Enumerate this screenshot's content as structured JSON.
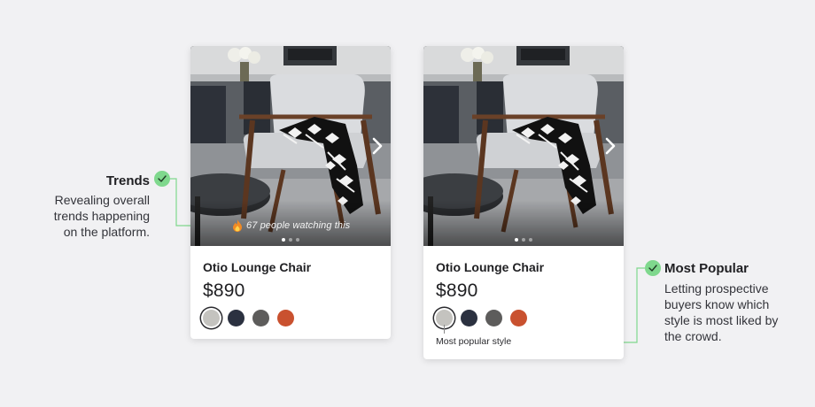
{
  "product_cards": [
    {
      "title": "Otio Lounge Chair",
      "price": "$890",
      "watching_text": "67 people watching this",
      "swatches": [
        {
          "name": "light-gray",
          "color": "#c4c3bf",
          "selected": true
        },
        {
          "name": "navy",
          "color": "#2b3140",
          "selected": false
        },
        {
          "name": "charcoal",
          "color": "#5d5c5b",
          "selected": false
        },
        {
          "name": "rust",
          "color": "#c9512f",
          "selected": false
        }
      ],
      "carousel_dots": 3,
      "active_dot": 1
    },
    {
      "title": "Otio Lounge Chair",
      "price": "$890",
      "popular_label": "Most popular style",
      "swatches": [
        {
          "name": "light-gray",
          "color": "#c4c3bf",
          "selected": true
        },
        {
          "name": "navy",
          "color": "#2b3140",
          "selected": false
        },
        {
          "name": "charcoal",
          "color": "#5d5c5b",
          "selected": false
        },
        {
          "name": "rust",
          "color": "#c9512f",
          "selected": false
        }
      ],
      "carousel_dots": 3,
      "active_dot": 1
    }
  ],
  "annotations": {
    "trends": {
      "title": "Trends",
      "lines": [
        "Revealing overall",
        "trends  happening",
        "on the platform."
      ]
    },
    "most_popular": {
      "title": "Most Popular",
      "lines": [
        "Letting prospective",
        "buyers know which",
        "style is most liked by",
        "the crowd."
      ]
    }
  },
  "colors": {
    "background": "#f1f1f3",
    "accent_green": "#7fd88d",
    "text_dark": "#1f1f22"
  },
  "icons": {
    "fire": "fire-icon",
    "next": "chevron-right-icon",
    "check": "check-icon"
  }
}
